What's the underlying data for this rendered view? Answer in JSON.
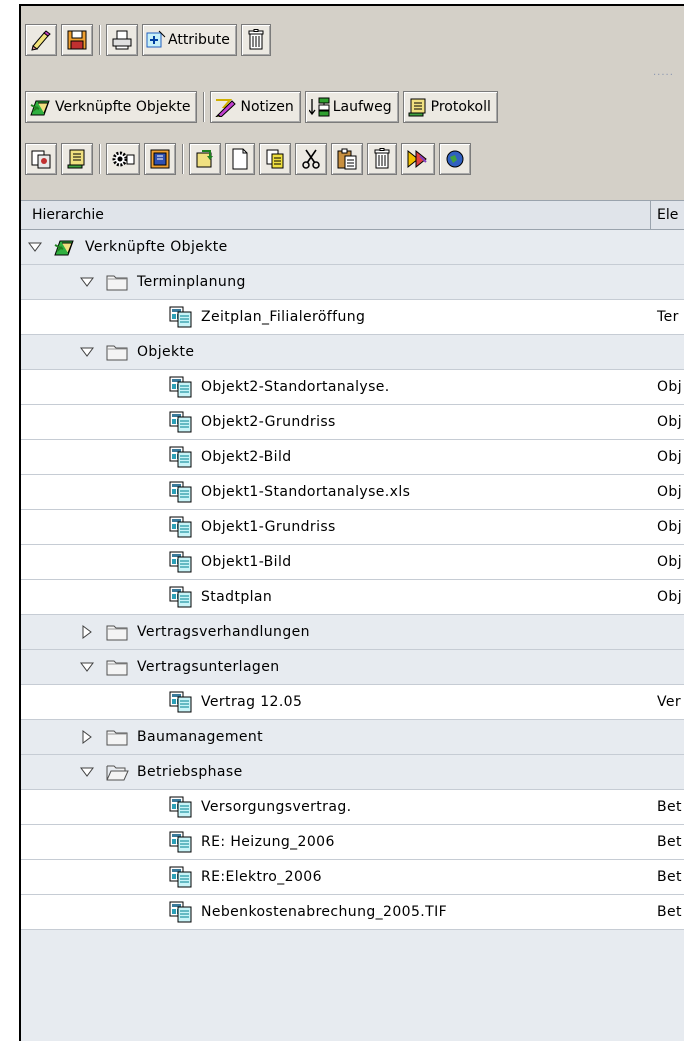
{
  "toolbar1": {
    "attribute_label": "Attribute"
  },
  "toolbar2": {
    "linked_objects_label": "Verknüpfte Objekte",
    "notes_label": "Notizen",
    "route_label": "Laufweg",
    "protocol_label": "Protokoll"
  },
  "grid": {
    "headers": {
      "hierarchy": "Hierarchie",
      "element": "Ele"
    },
    "rows": [
      {
        "label": "Verknüpfte Objekte",
        "col2": "",
        "level": 0,
        "kind": "root",
        "state": "expanded"
      },
      {
        "label": "Terminplanung",
        "col2": "",
        "level": 1,
        "kind": "folder",
        "state": "expanded"
      },
      {
        "label": "Zeitplan_Filialeröffung",
        "col2": "Ter",
        "level": 2,
        "kind": "doc"
      },
      {
        "label": "Objekte",
        "col2": "",
        "level": 1,
        "kind": "folder",
        "state": "expanded"
      },
      {
        "label": "Objekt2-Standortanalyse.",
        "col2": "Obj",
        "level": 2,
        "kind": "doc"
      },
      {
        "label": "Objekt2-Grundriss",
        "col2": "Obj",
        "level": 2,
        "kind": "doc"
      },
      {
        "label": "Objekt2-Bild",
        "col2": "Obj",
        "level": 2,
        "kind": "doc"
      },
      {
        "label": "Objekt1-Standortanalyse.xls",
        "col2": "Obj",
        "level": 2,
        "kind": "doc"
      },
      {
        "label": "Objekt1-Grundriss",
        "col2": "Obj",
        "level": 2,
        "kind": "doc"
      },
      {
        "label": "Objekt1-Bild",
        "col2": "Obj",
        "level": 2,
        "kind": "doc"
      },
      {
        "label": "Stadtplan",
        "col2": "Obj",
        "level": 2,
        "kind": "doc"
      },
      {
        "label": "Vertragsverhandlungen",
        "col2": "",
        "level": 1,
        "kind": "folder",
        "state": "collapsed"
      },
      {
        "label": "Vertragsunterlagen",
        "col2": "",
        "level": 1,
        "kind": "folder",
        "state": "expanded"
      },
      {
        "label": "Vertrag 12.05",
        "col2": "Ver",
        "level": 2,
        "kind": "doc"
      },
      {
        "label": "Baumanagement",
        "col2": "",
        "level": 1,
        "kind": "folder",
        "state": "collapsed"
      },
      {
        "label": "Betriebsphase",
        "col2": "",
        "level": 1,
        "kind": "folder-open",
        "state": "expanded"
      },
      {
        "label": "Versorgungsvertrag.",
        "col2": "Bet",
        "level": 2,
        "kind": "doc"
      },
      {
        "label": "RE: Heizung_2006",
        "col2": "Bet",
        "level": 2,
        "kind": "doc"
      },
      {
        "label": "RE:Elektro_2006",
        "col2": "Bet",
        "level": 2,
        "kind": "doc"
      },
      {
        "label": "Nebenkostenabrechung_2005.TIF",
        "col2": "Bet",
        "level": 2,
        "kind": "doc"
      }
    ]
  }
}
